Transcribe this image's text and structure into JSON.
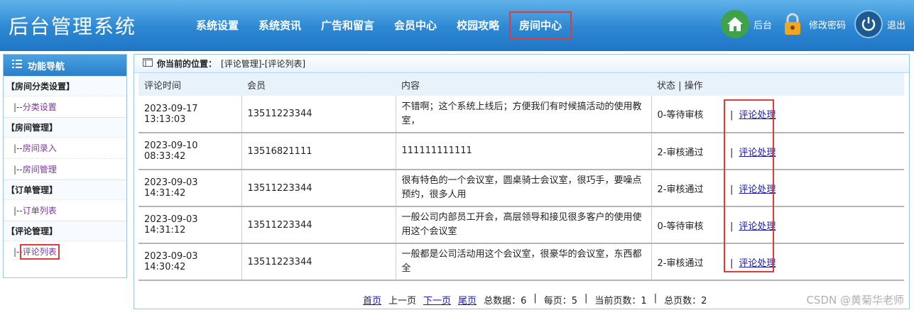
{
  "app": {
    "title": "后台管理系统"
  },
  "nav": {
    "items": [
      "系统设置",
      "系统资讯",
      "广告和留言",
      "会员中心",
      "校园攻略",
      "房间中心"
    ]
  },
  "tools": {
    "home_label": "后台",
    "password_label": "修改密码",
    "logout_label": "退出"
  },
  "sidebar": {
    "title": "功能导航",
    "groups": [
      {
        "title": "【房间分类设置】",
        "items": [
          {
            "prefix": "|--",
            "label": "分类设置"
          }
        ]
      },
      {
        "title": "【房间管理】",
        "items": [
          {
            "prefix": "|--",
            "label": "房间录入"
          },
          {
            "prefix": "|--",
            "label": "房间管理"
          }
        ]
      },
      {
        "title": "【订单管理】",
        "items": [
          {
            "prefix": "|--",
            "label": "订单列表"
          }
        ]
      },
      {
        "title": "【评论管理】",
        "items": [
          {
            "prefix": "|--",
            "label": "评论列表"
          }
        ]
      }
    ]
  },
  "breadcrumb": {
    "label": "你当前的位置：",
    "path": "[评论管理]-[评论列表]"
  },
  "table": {
    "headers": [
      "评论时间",
      "会员",
      "内容",
      "状态 | 操作"
    ],
    "rows": [
      {
        "date": "2023-09-17",
        "time": "13:13:03",
        "member": "13511223344",
        "content": "不错啊；这个系统上线后；方便我们有时候搞活动的使用教室，",
        "status": "0-等待审核",
        "action": "评论处理"
      },
      {
        "date": "2023-09-10",
        "time": "08:33:42",
        "member": "13516821111",
        "content": "111111111111",
        "status": "2-审核通过",
        "action": "评论处理"
      },
      {
        "date": "2023-09-03",
        "time": "14:31:42",
        "member": "13511223344",
        "content": "很有特色的一个会议室，圆桌骑士会议室，很巧手，要噪点预约，很多人用",
        "status": "2-审核通过",
        "action": "评论处理"
      },
      {
        "date": "2023-09-03",
        "time": "14:31:12",
        "member": "13511223344",
        "content": "一般公司内部员工开会，高层领导和接见很多客户的使用使用这个会议室",
        "status": "0-等待审核",
        "action": "评论处理"
      },
      {
        "date": "2023-09-03",
        "time": "14:30:42",
        "member": "13511223344",
        "content": "一般都是公司活动用这个会议室，很豪华的会议室，东西都全",
        "status": "2-审核通过",
        "action": "评论处理"
      }
    ]
  },
  "pager": {
    "first": "首页",
    "prev": "上一页",
    "next": "下一页",
    "last": "尾页",
    "total": "总数据：6",
    "per_page": "每页：5",
    "current": "当前页数：1",
    "pages": "总页数：2"
  },
  "watermark": "CSDN @黄菊华老师"
}
